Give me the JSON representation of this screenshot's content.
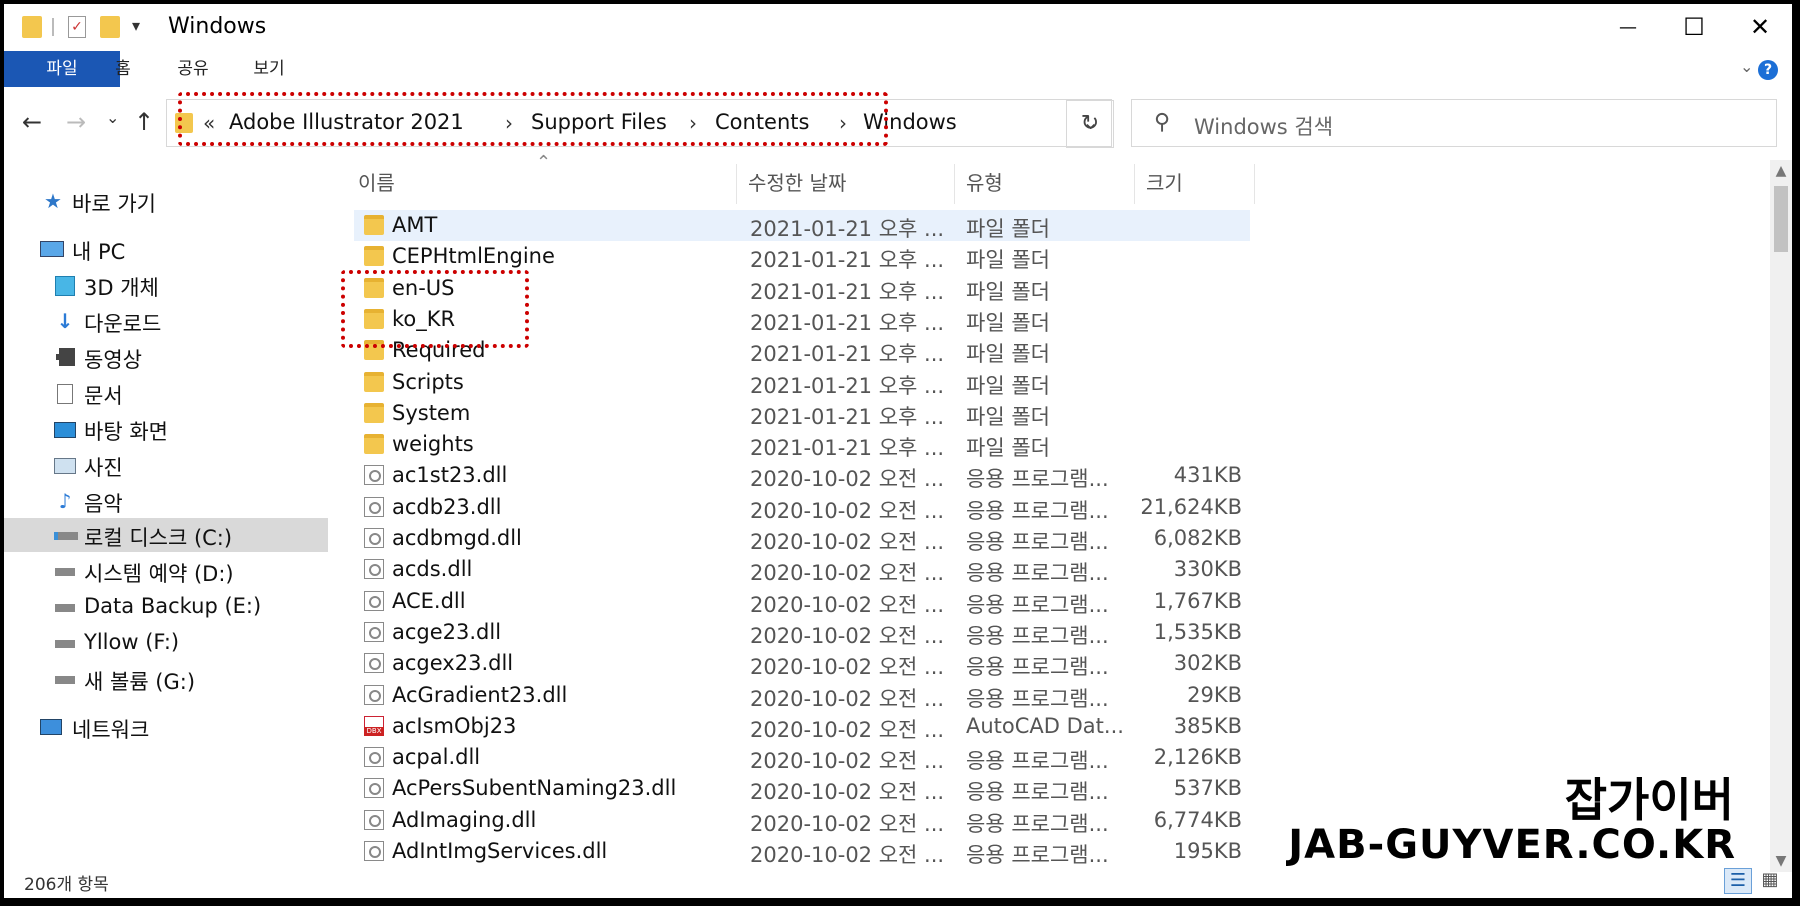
{
  "window": {
    "title": "Windows",
    "minimize": "—",
    "maximize": "☐",
    "close": "✕"
  },
  "ribbon": {
    "tabs": [
      "파일",
      "홈",
      "공유",
      "보기"
    ],
    "expand": "⌄",
    "help": "?"
  },
  "nav_buttons": {
    "back": "←",
    "forward": "→",
    "recent": "⌄",
    "up": "↑"
  },
  "address": {
    "overflow": "«",
    "crumbs": [
      "Adobe Illustrator 2021",
      "Support Files",
      "Contents",
      "Windows"
    ],
    "separator": "›",
    "dropdown": "⌄",
    "refresh": "↻"
  },
  "search": {
    "placeholder": "Windows 검색"
  },
  "nav_pane": [
    {
      "label": "바로 가기",
      "icon": "star-icon"
    },
    {
      "label": "내 PC",
      "icon": "computer-icon"
    },
    {
      "label": "3D 개체",
      "icon": "cube-icon"
    },
    {
      "label": "다운로드",
      "icon": "download-icon"
    },
    {
      "label": "동영상",
      "icon": "video-icon"
    },
    {
      "label": "문서",
      "icon": "document-icon"
    },
    {
      "label": "바탕 화면",
      "icon": "desktop-icon"
    },
    {
      "label": "사진",
      "icon": "picture-icon"
    },
    {
      "label": "음악",
      "icon": "music-icon"
    },
    {
      "label": "로컬 디스크 (C:)",
      "icon": "drive-icon"
    },
    {
      "label": "시스템 예약 (D:)",
      "icon": "drive-icon"
    },
    {
      "label": "Data Backup (E:)",
      "icon": "drive-icon"
    },
    {
      "label": "Yllow (F:)",
      "icon": "drive-icon"
    },
    {
      "label": "새 볼륨 (G:)",
      "icon": "drive-icon"
    },
    {
      "label": "네트워크",
      "icon": "network-icon"
    }
  ],
  "columns": [
    "이름",
    "수정한 날짜",
    "유형",
    "크기"
  ],
  "sort_indicator": "⌃",
  "files": [
    {
      "name": "AMT",
      "date": "2021-01-21 오후 ...",
      "type": "파일 폴더",
      "size": "",
      "icon": "folder-icon"
    },
    {
      "name": "CEPHtmlEngine",
      "date": "2021-01-21 오후 ...",
      "type": "파일 폴더",
      "size": "",
      "icon": "folder-icon"
    },
    {
      "name": "en-US",
      "date": "2021-01-21 오후 ...",
      "type": "파일 폴더",
      "size": "",
      "icon": "folder-icon"
    },
    {
      "name": "ko_KR",
      "date": "2021-01-21 오후 ...",
      "type": "파일 폴더",
      "size": "",
      "icon": "folder-icon"
    },
    {
      "name": "Required",
      "date": "2021-01-21 오후 ...",
      "type": "파일 폴더",
      "size": "",
      "icon": "folder-icon"
    },
    {
      "name": "Scripts",
      "date": "2021-01-21 오후 ...",
      "type": "파일 폴더",
      "size": "",
      "icon": "folder-icon"
    },
    {
      "name": "System",
      "date": "2021-01-21 오후 ...",
      "type": "파일 폴더",
      "size": "",
      "icon": "folder-icon"
    },
    {
      "name": "weights",
      "date": "2021-01-21 오후 ...",
      "type": "파일 폴더",
      "size": "",
      "icon": "folder-icon"
    },
    {
      "name": "ac1st23.dll",
      "date": "2020-10-02 오전 ...",
      "type": "응용 프로그램...",
      "size": "431KB",
      "icon": "dll-icon"
    },
    {
      "name": "acdb23.dll",
      "date": "2020-10-02 오전 ...",
      "type": "응용 프로그램...",
      "size": "21,624KB",
      "icon": "dll-icon"
    },
    {
      "name": "acdbmgd.dll",
      "date": "2020-10-02 오전 ...",
      "type": "응용 프로그램...",
      "size": "6,082KB",
      "icon": "dll-icon"
    },
    {
      "name": "acds.dll",
      "date": "2020-10-02 오전 ...",
      "type": "응용 프로그램...",
      "size": "330KB",
      "icon": "dll-icon"
    },
    {
      "name": "ACE.dll",
      "date": "2020-10-02 오전 ...",
      "type": "응용 프로그램...",
      "size": "1,767KB",
      "icon": "dll-icon"
    },
    {
      "name": "acge23.dll",
      "date": "2020-10-02 오전 ...",
      "type": "응용 프로그램...",
      "size": "1,535KB",
      "icon": "dll-icon"
    },
    {
      "name": "acgex23.dll",
      "date": "2020-10-02 오전 ...",
      "type": "응용 프로그램...",
      "size": "302KB",
      "icon": "dll-icon"
    },
    {
      "name": "AcGradient23.dll",
      "date": "2020-10-02 오전 ...",
      "type": "응용 프로그램...",
      "size": "29KB",
      "icon": "dll-icon"
    },
    {
      "name": "acIsmObj23",
      "date": "2020-10-02 오전 ...",
      "type": "AutoCAD Dat...",
      "size": "385KB",
      "icon": "dbx-icon"
    },
    {
      "name": "acpal.dll",
      "date": "2020-10-02 오전 ...",
      "type": "응용 프로그램...",
      "size": "2,126KB",
      "icon": "dll-icon"
    },
    {
      "name": "AcPersSubentNaming23.dll",
      "date": "2020-10-02 오전 ...",
      "type": "응용 프로그램...",
      "size": "537KB",
      "icon": "dll-icon"
    },
    {
      "name": "AdImaging.dll",
      "date": "2020-10-02 오전 ...",
      "type": "응용 프로그램...",
      "size": "6,774KB",
      "icon": "dll-icon"
    },
    {
      "name": "AdIntImgServices.dll",
      "date": "2020-10-02 오전 ...",
      "type": "응용 프로그램...",
      "size": "195KB",
      "icon": "dll-icon"
    }
  ],
  "status": {
    "item_count": "206개 항목"
  },
  "watermark": {
    "korean": "잡가이버",
    "english": "JAB-GUYVER.CO.KR"
  },
  "colors": {
    "accent": "#1b57b4",
    "folder": "#f3c74e",
    "highlight": "#cc0000"
  }
}
